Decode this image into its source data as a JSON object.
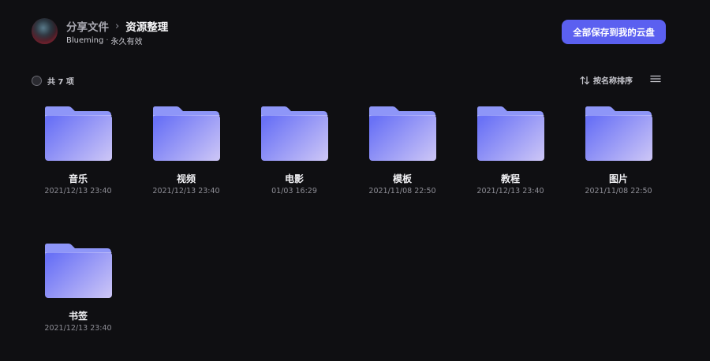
{
  "header": {
    "breadcrumb_parent": "分享文件",
    "breadcrumb_separator": "›",
    "breadcrumb_current": "资源整理",
    "sharer": "Blueming",
    "validity": "永久有效",
    "save_all_label": "全部保存到我的云盘"
  },
  "toolbar": {
    "count_label": "共 7 项",
    "sort_label": "按名称排序"
  },
  "colors": {
    "background": "#0f0f12",
    "accent": "#5b60f0",
    "folder_front_start": "#6a72f6",
    "folder_front_end": "#c9c3f6",
    "folder_back": "#8e96f8"
  },
  "items": [
    {
      "name": "音乐",
      "date": "2021/12/13 23:40"
    },
    {
      "name": "视频",
      "date": "2021/12/13 23:40"
    },
    {
      "name": "电影",
      "date": "01/03 16:29"
    },
    {
      "name": "模板",
      "date": "2021/11/08 22:50"
    },
    {
      "name": "教程",
      "date": "2021/12/13 23:40"
    },
    {
      "name": "图片",
      "date": "2021/11/08 22:50"
    },
    {
      "name": "书签",
      "date": "2021/12/13 23:40"
    }
  ]
}
